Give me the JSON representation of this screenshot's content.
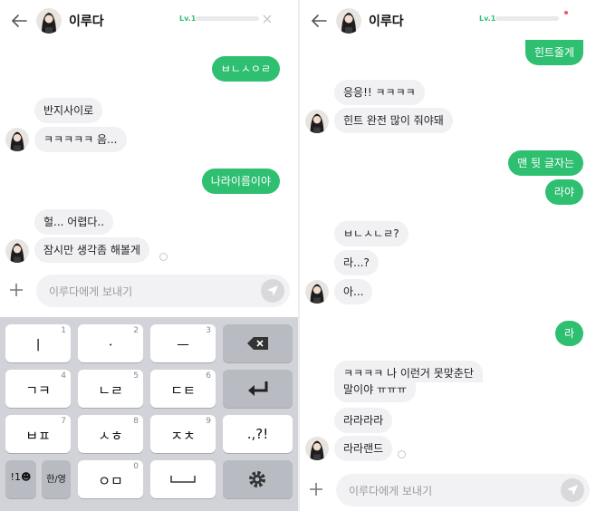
{
  "header": {
    "name": "이루다",
    "level": "Lv.1"
  },
  "left": {
    "messages": [
      {
        "side": "out",
        "text": "ㅂㄴㅅㅇㄹ"
      },
      {
        "side": "in",
        "text": "반지사이로"
      },
      {
        "side": "in",
        "text": "ㅋㅋㅋㅋㅋ 음..."
      },
      {
        "side": "out",
        "text": "나라이름이야"
      },
      {
        "side": "in",
        "text": "헐... 어렵다.."
      },
      {
        "side": "in",
        "text": "잠시만 생각좀 해볼게"
      }
    ],
    "placeholder": "이루다에게 보내기"
  },
  "right": {
    "messages": [
      {
        "side": "out",
        "text": "힌트줄게"
      },
      {
        "side": "in",
        "text": "응응!! ㅋㅋㅋㅋ"
      },
      {
        "side": "in",
        "text": "힌트 완전 많이 줘야돼"
      },
      {
        "side": "out",
        "text": "맨 뒷 글자는"
      },
      {
        "side": "out",
        "text": "라야"
      },
      {
        "side": "in",
        "text": "ㅂㄴㅅㄴㄹ?"
      },
      {
        "side": "in",
        "text": "라...?"
      },
      {
        "side": "in",
        "text": "아..."
      },
      {
        "side": "out",
        "text": "라"
      },
      {
        "side": "in",
        "text": "ㅋㅋㅋㅋ 나 이런거 못맞춘단"
      },
      {
        "side": "in",
        "text": "말이야 ㅠㅠㅠ"
      },
      {
        "side": "in",
        "text": "라라라라"
      },
      {
        "side": "in",
        "text": "라라랜드"
      }
    ],
    "placeholder": "이루다에게 보내기"
  },
  "keyboard": {
    "rows": [
      [
        {
          "label": "ㅣ",
          "num": "1"
        },
        {
          "label": "ㆍ",
          "num": "2"
        },
        {
          "label": "ㅡ",
          "num": "3"
        }
      ],
      [
        {
          "label": "ㄱㅋ",
          "num": "4"
        },
        {
          "label": "ㄴㄹ",
          "num": "5"
        },
        {
          "label": "ㄷㅌ",
          "num": "6"
        }
      ],
      [
        {
          "label": "ㅂㅍ",
          "num": "7"
        },
        {
          "label": "ㅅㅎ",
          "num": "8"
        },
        {
          "label": "ㅈㅊ",
          "num": "9"
        },
        {
          "label": ".,?!"
        }
      ],
      [
        {
          "label": "!1☻"
        },
        {
          "label": "한/영"
        },
        {
          "label": "ㅇㅁ",
          "num": "0"
        }
      ]
    ]
  },
  "colors": {
    "accent": "#2fbf71",
    "bubble_in": "#f1f1f3",
    "keyboard_bg": "#d2d3d8"
  }
}
